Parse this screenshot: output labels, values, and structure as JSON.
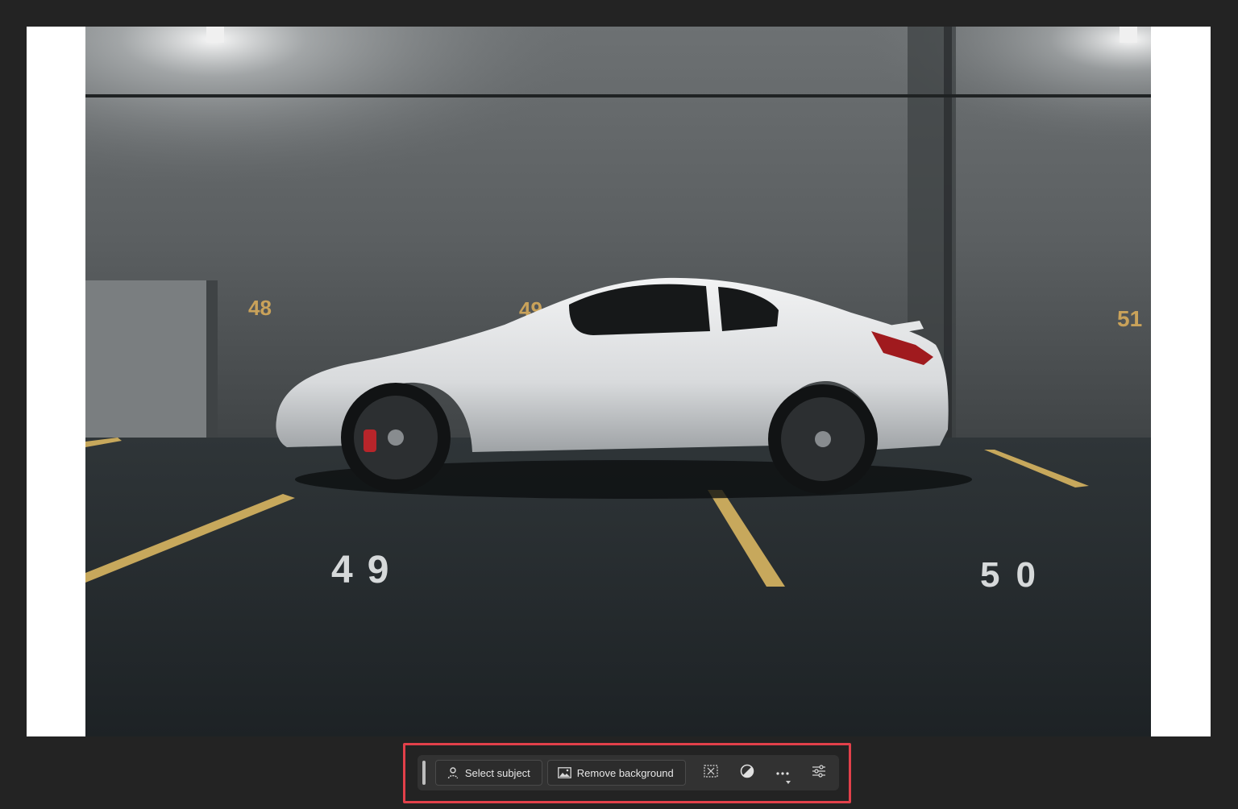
{
  "canvas": {
    "background": "#232323",
    "document_background": "#ffffff"
  },
  "photo": {
    "stall_numbers": [
      "48",
      "49",
      "51"
    ],
    "floor_numbers": [
      "49",
      "50"
    ]
  },
  "taskbar": {
    "select_subject_label": "Select subject",
    "remove_background_label": "Remove background",
    "icons": [
      "person-select-icon",
      "image-icon",
      "transform-icon",
      "adjustment-circle-icon",
      "more-options-icon",
      "settings-sliders-icon"
    ],
    "highlight_color": "#e2404a"
  }
}
